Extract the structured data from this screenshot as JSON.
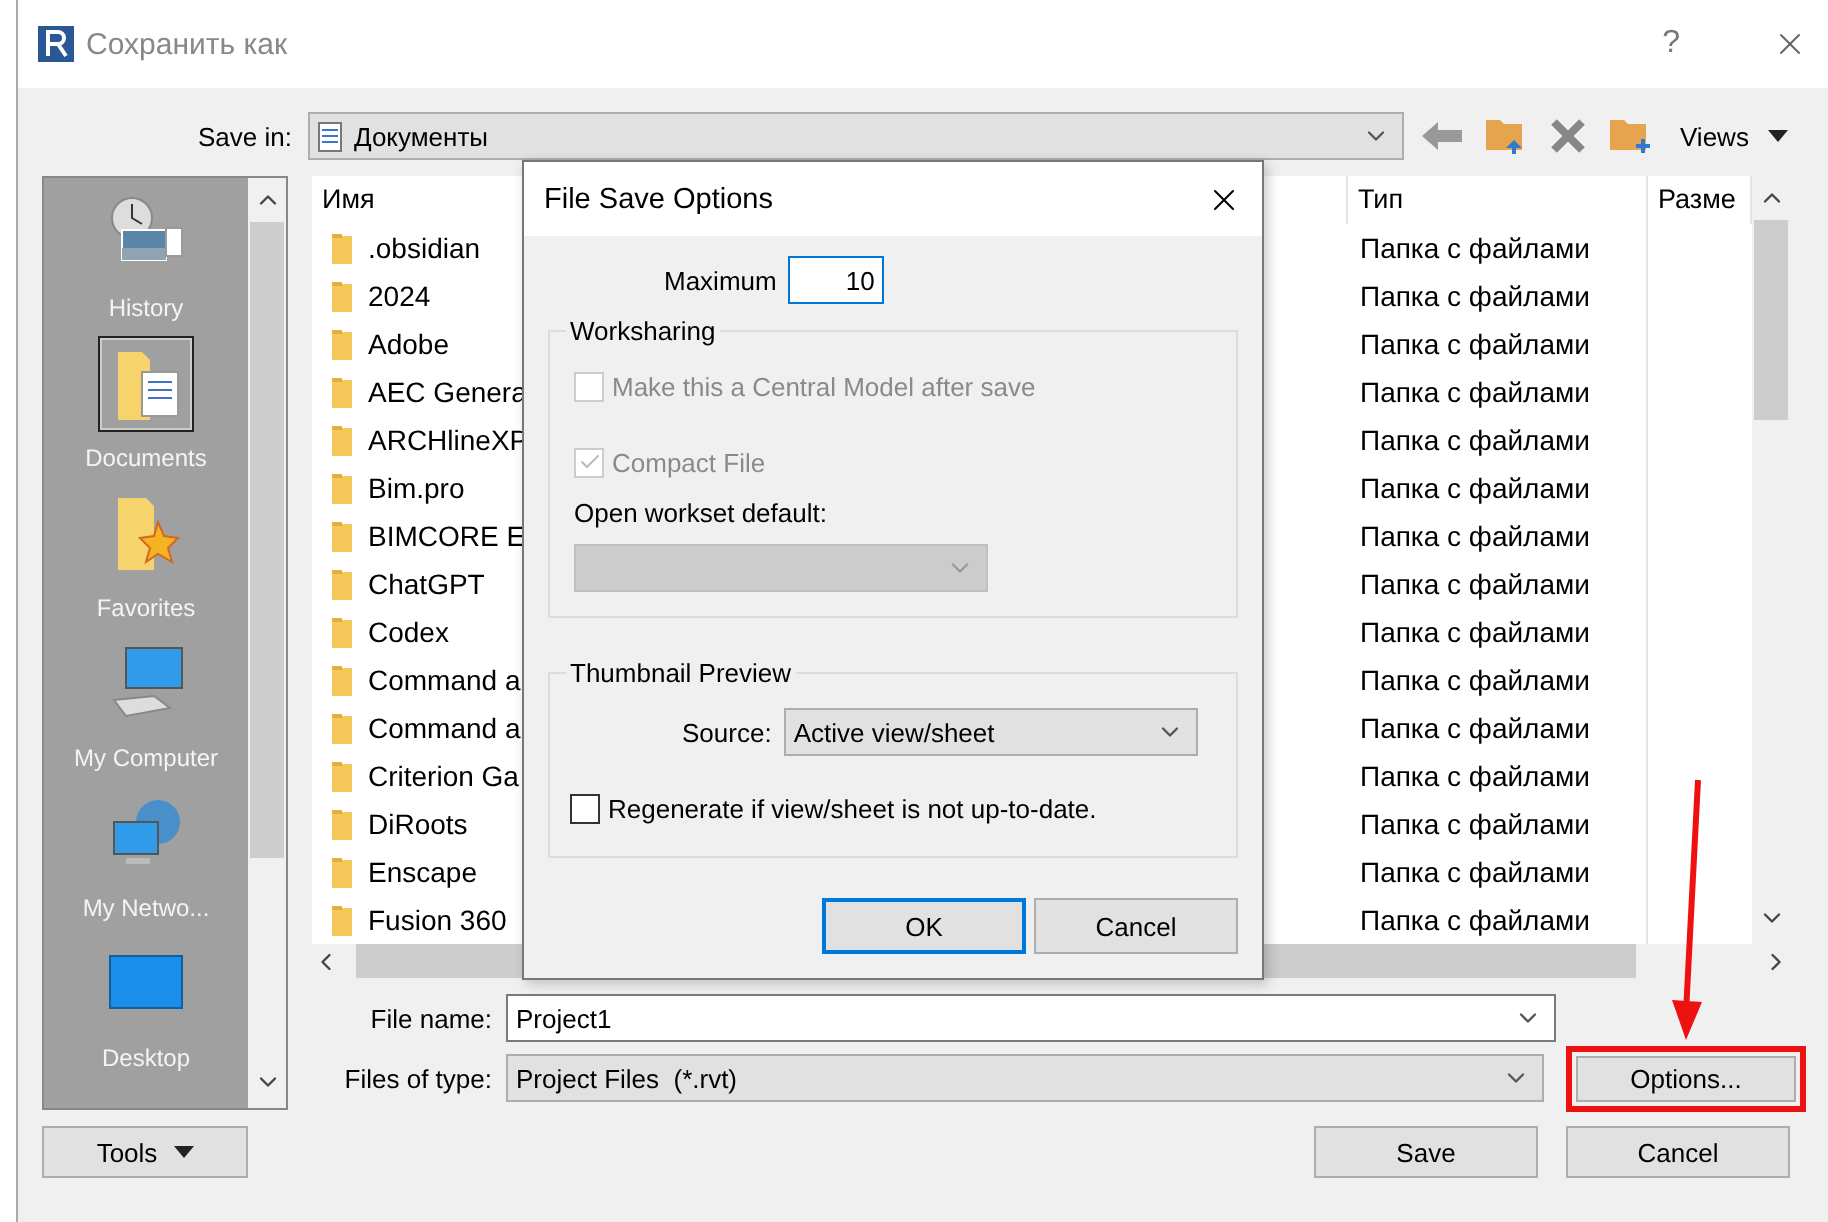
{
  "window": {
    "title": "Сохранить как",
    "help": "?"
  },
  "save_in": {
    "label": "Save in:",
    "value": "Документы"
  },
  "toolbar": {
    "views": "Views"
  },
  "places": [
    {
      "label": "History",
      "kind": "history",
      "selected": false
    },
    {
      "label": "Documents",
      "kind": "documents",
      "selected": true
    },
    {
      "label": "Favorites",
      "kind": "favorites",
      "selected": false
    },
    {
      "label": "My Computer",
      "kind": "computer",
      "selected": false
    },
    {
      "label": "My Netwo...",
      "kind": "network",
      "selected": false
    },
    {
      "label": "Desktop",
      "kind": "desktop",
      "selected": false
    }
  ],
  "file_list": {
    "columns": [
      "Имя",
      "Тип",
      "Разме"
    ],
    "rows": [
      {
        "name": ".obsidian",
        "type": "Папка с файлами"
      },
      {
        "name": "2024",
        "type": "Папка с файлами"
      },
      {
        "name": "Adobe",
        "type": "Папка с файлами"
      },
      {
        "name": "AEC Genera",
        "type": "Папка с файлами"
      },
      {
        "name": "ARCHlineXP",
        "type": "Папка с файлами"
      },
      {
        "name": "Bim.pro",
        "type": "Папка с файлами"
      },
      {
        "name": "BIMCORE E",
        "type": "Папка с файлами"
      },
      {
        "name": "ChatGPT",
        "type": "Папка с файлами"
      },
      {
        "name": "Codex",
        "type": "Папка с файлами"
      },
      {
        "name": "Command a",
        "type": "Папка с файлами"
      },
      {
        "name": "Command a",
        "type": "Папка с файлами"
      },
      {
        "name": "Criterion Ga",
        "type": "Папка с файлами"
      },
      {
        "name": "DiRoots",
        "type": "Папка с файлами"
      },
      {
        "name": "Enscape",
        "type": "Папка с файлами"
      },
      {
        "name": "Fusion 360",
        "type": "Папка с файлами"
      }
    ]
  },
  "file_name": {
    "label": "File name:",
    "value": "Project1"
  },
  "file_type": {
    "label": "Files of type:",
    "value": "Project Files  (*.rvt)"
  },
  "buttons": {
    "tools": "Tools",
    "options": "Options...",
    "options_highlighted": true,
    "save": "Save",
    "cancel": "Cancel"
  },
  "dialog": {
    "title": "File Save Options",
    "maximum_label": "Maximum",
    "maximum_value": "10",
    "worksharing": {
      "title": "Worksharing",
      "options": [
        {
          "label": "Make this a Central Model after save",
          "checked": false,
          "disabled": true
        },
        {
          "label": "Compact File",
          "checked": true,
          "disabled": true
        }
      ],
      "workset_label": "Open workset default:"
    },
    "thumbnail": {
      "title": "Thumbnail Preview",
      "source_label": "Source:",
      "source_value": "Active view/sheet",
      "regenerate": {
        "label": "Regenerate if view/sheet is not up-to-date.",
        "checked": false,
        "disabled": false
      }
    },
    "ok": "OK",
    "cancel": "Cancel"
  }
}
